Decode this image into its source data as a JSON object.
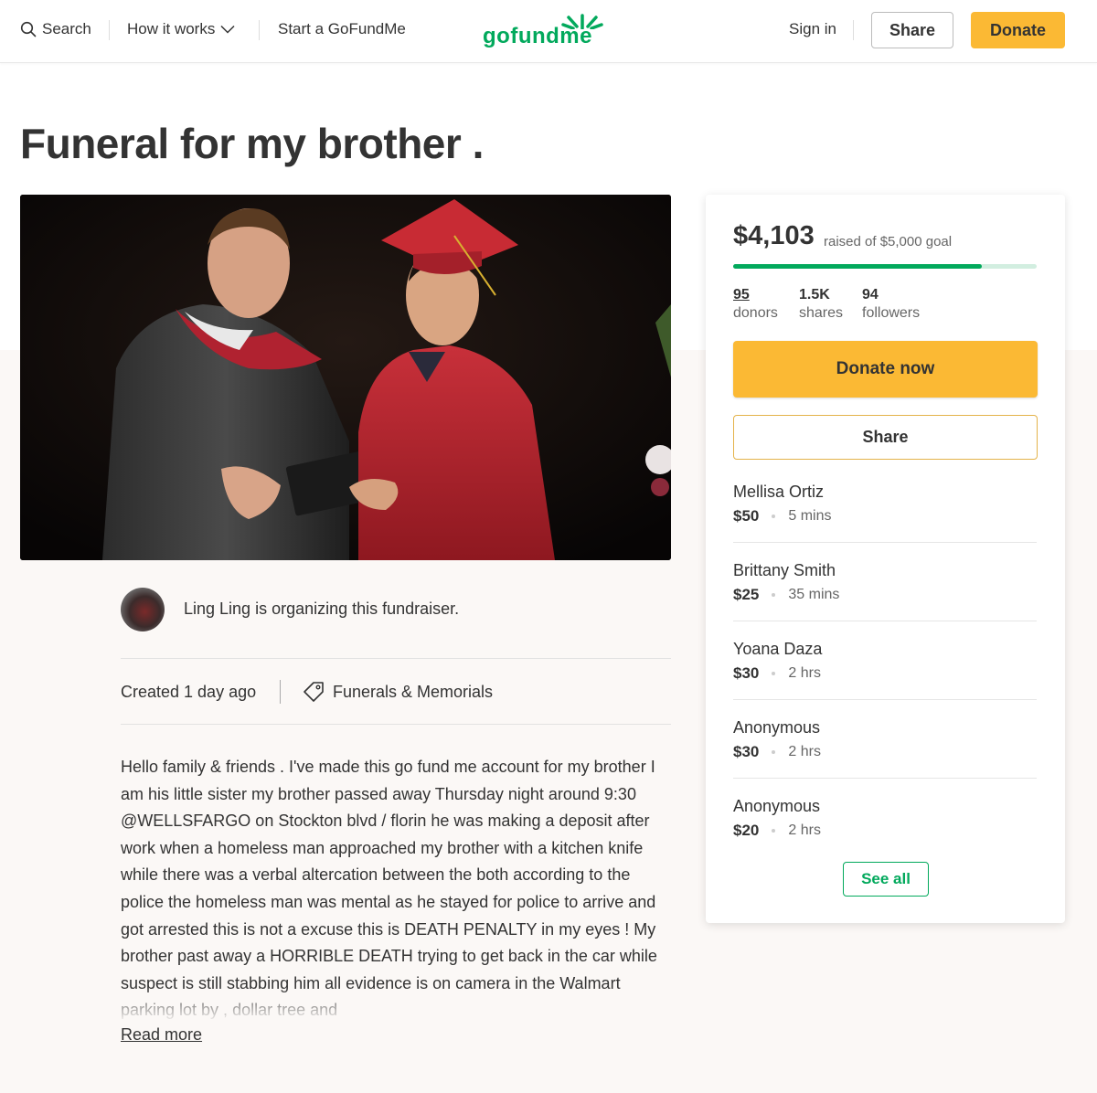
{
  "header": {
    "search_label": "Search",
    "how_it_works_label": "How it works",
    "start_label": "Start a GoFundMe",
    "logo_text": "gofundme",
    "signin_label": "Sign in",
    "share_label": "Share",
    "donate_label": "Donate"
  },
  "campaign": {
    "title": "Funeral for my brother .",
    "organizer_text": "Ling Ling is organizing this fundraiser.",
    "created": "Created 1 day ago",
    "category": "Funerals & Memorials",
    "story": "Hello family & friends . I've made this go fund me account for my brother I am his little sister my brother passed away Thursday night around 9:30 @WELLSFARGO on Stockton blvd / florin he was making a deposit after work when a homeless man approached my brother with a kitchen knife while there was a verbal altercation between the both according to the police the homeless man was mental as he stayed for police to arrive and got arrested this is not a excuse this is DEATH PENALTY in my eyes ! My brother past away a HORRIBLE DEATH trying to get back in the car while suspect is still stabbing him all evidence is on camera in the Walmart parking lot by , dollar tree and",
    "read_more_label": "Read more"
  },
  "sidebar": {
    "raised": "$4,103",
    "raised_of": "raised of $5,000 goal",
    "progress_fraction": 0.8206,
    "stats": {
      "donors_count": "95",
      "donors_label": "donors",
      "shares_count": "1.5K",
      "shares_label": "shares",
      "followers_count": "94",
      "followers_label": "followers"
    },
    "donate_now_label": "Donate now",
    "share_label": "Share",
    "donations": [
      {
        "name": "Mellisa Ortiz",
        "amount": "$50",
        "time": "5 mins"
      },
      {
        "name": "Brittany Smith",
        "amount": "$25",
        "time": "35 mins"
      },
      {
        "name": "Yoana Daza",
        "amount": "$30",
        "time": "2 hrs"
      },
      {
        "name": "Anonymous",
        "amount": "$30",
        "time": "2 hrs"
      },
      {
        "name": "Anonymous",
        "amount": "$20",
        "time": "2 hrs"
      }
    ],
    "see_all_label": "See all"
  },
  "colors": {
    "brand_green": "#02a95c",
    "donate_yellow": "#fbb934",
    "progress_track": "#d2eee0"
  },
  "icons": {
    "search": "search-icon",
    "chevron": "chevron-down-icon",
    "tag": "tag-icon",
    "logo_sprout": "sprout-icon"
  }
}
